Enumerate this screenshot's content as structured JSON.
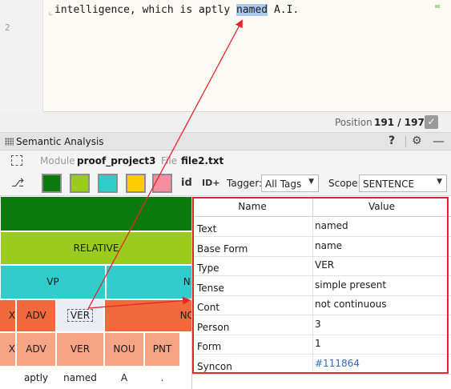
{
  "editor": {
    "line1_before": "intelligence, which is aptly ",
    "line1_highlight": "named",
    "line1_after": " A.I.",
    "line2_number": "2"
  },
  "status": {
    "position_label": "Position",
    "position_value": "191 / 197"
  },
  "toolwindow": {
    "title": "Semantic Analysis",
    "help": "?",
    "gear": "✲",
    "minimize": "—"
  },
  "module": {
    "label": "Module",
    "value": "proof_project3",
    "file_label": "File",
    "file_value": "file2.txt"
  },
  "toolbar": {
    "swatches": [
      {
        "name": "dark-green",
        "color": "#0b7a0e"
      },
      {
        "name": "light-green",
        "color": "#99cc1c"
      },
      {
        "name": "cyan",
        "color": "#33cccc"
      },
      {
        "name": "yellow",
        "color": "#ffcc00"
      },
      {
        "name": "pink",
        "color": "#f58fa0"
      }
    ],
    "id_label": "id",
    "idplus_label": "ID+",
    "tagger_label": "Tagger:",
    "tagger_value": "All Tags",
    "scope_label": "Scope:",
    "scope_value": "SENTENCE"
  },
  "tree": {
    "relative_label": "RELATIVE",
    "vp_label": "VP",
    "np_partial": "NP",
    "row4": {
      "x": "X",
      "adv": "ADV",
      "ver": "VER",
      "no": "NO"
    },
    "row5": {
      "x": "X",
      "adv": "ADV",
      "ver": "VER",
      "nou": "NOU",
      "pnt": "PNT"
    },
    "words": [
      "aptly",
      "named",
      "A",
      "."
    ],
    "colors": {
      "sentence": "#0b7a0e",
      "relative": "#99cc1c",
      "phrase": "#33cccc",
      "word_orange": "#f26a3c",
      "word_selected": "#ececf8",
      "token_salmon": "#f5a585"
    }
  },
  "props": {
    "header_name": "Name",
    "header_value": "Value",
    "rows": [
      {
        "name": "Text",
        "value": "named"
      },
      {
        "name": "Base Form",
        "value": "name"
      },
      {
        "name": "Type",
        "value": "VER"
      },
      {
        "name": "Tense",
        "value": "simple present"
      },
      {
        "name": "Cont",
        "value": "not continuous"
      },
      {
        "name": "Person",
        "value": "3"
      },
      {
        "name": "Form",
        "value": "1"
      },
      {
        "name": "Syncon",
        "value": "#111864"
      }
    ]
  },
  "annotation": {
    "arrow_color": "#e3262b"
  }
}
